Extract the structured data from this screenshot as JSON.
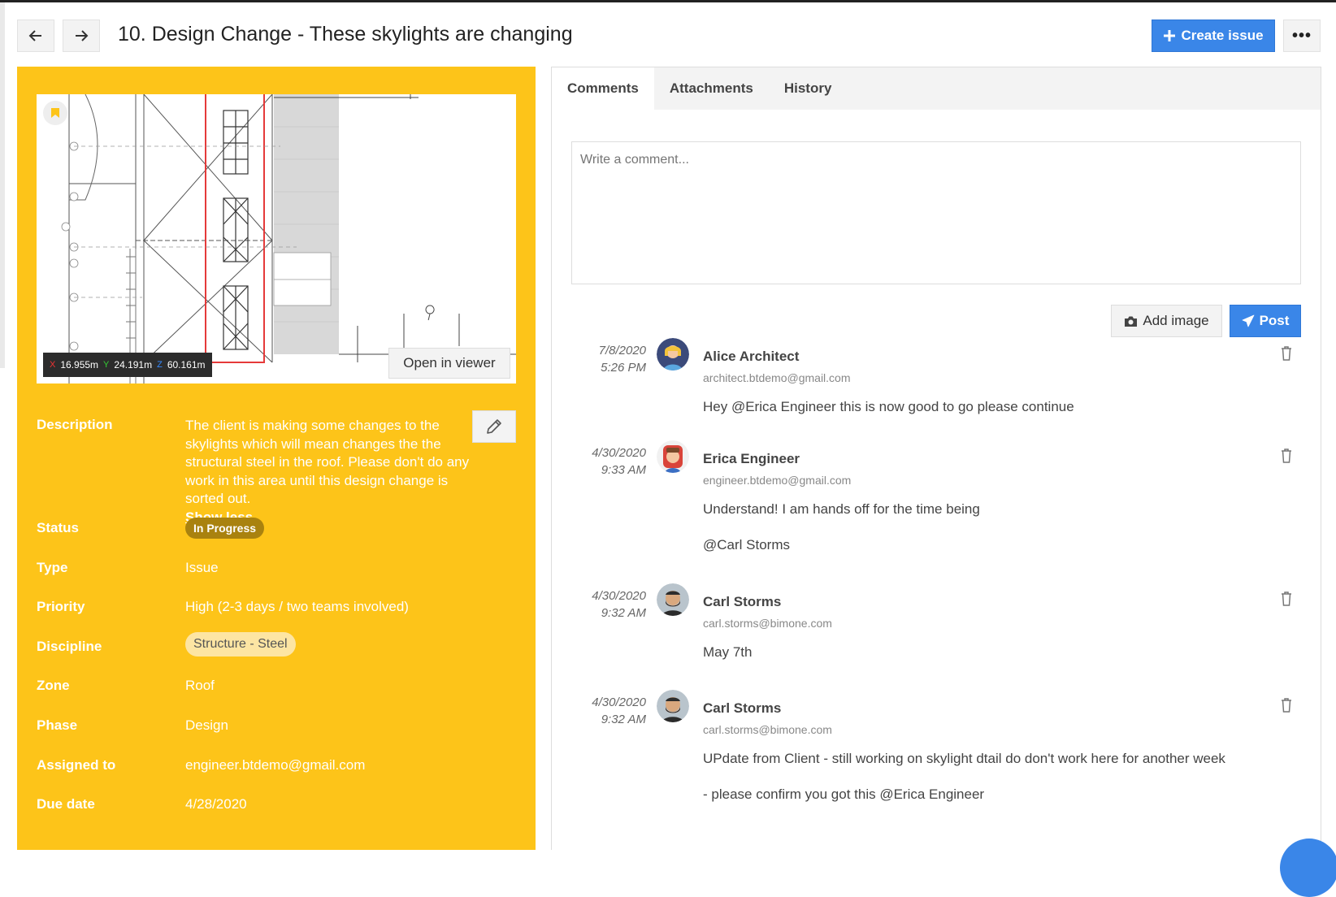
{
  "header": {
    "title": "10. Design Change - These skylights are changing",
    "create_label": "Create issue",
    "more_label": "•••"
  },
  "preview": {
    "coords": {
      "x": "16.955m",
      "y": "24.191m",
      "z": "60.161m"
    },
    "open_viewer_label": "Open in viewer"
  },
  "details": {
    "description_label": "Description",
    "description_text": "The client is making some changes to the skylights which will mean changes the the structural steel in the roof. Please don't do any work in this area until this design change is sorted out.",
    "show_less": "Show less",
    "status_label": "Status",
    "status_value": "In Progress",
    "type_label": "Type",
    "type_value": "Issue",
    "priority_label": "Priority",
    "priority_value": "High (2-3 days / two teams involved)",
    "discipline_label": "Discipline",
    "discipline_value": "Structure - Steel",
    "zone_label": "Zone",
    "zone_value": "Roof",
    "phase_label": "Phase",
    "phase_value": "Design",
    "assigned_label": "Assigned to",
    "assigned_value": "engineer.btdemo@gmail.com",
    "due_label": "Due date",
    "due_value": "4/28/2020"
  },
  "tabs": [
    "Comments",
    "Attachments",
    "History"
  ],
  "composer": {
    "placeholder": "Write a comment...",
    "add_image_label": "Add image",
    "post_label": "Post"
  },
  "comments": [
    {
      "date": "7/8/2020",
      "time": "5:26 PM",
      "name": "Alice Architect",
      "email": "architect.btdemo@gmail.com",
      "lines": [
        "Hey @Erica Engineer  this is now good to go please continue"
      ]
    },
    {
      "date": "4/30/2020",
      "time": "9:33 AM",
      "name": "Erica Engineer",
      "email": "engineer.btdemo@gmail.com",
      "lines": [
        "Understand! I am hands off for the time being",
        "@Carl Storms"
      ]
    },
    {
      "date": "4/30/2020",
      "time": "9:32 AM",
      "name": "Carl Storms",
      "email": "carl.storms@bimone.com",
      "lines": [
        "May 7th"
      ]
    },
    {
      "date": "4/30/2020",
      "time": "9:32 AM",
      "name": "Carl Storms",
      "email": "carl.storms@bimone.com",
      "lines": [
        "UPdate from Client - still working on skylight dtail do don't work here for another week",
        "- please confirm you got this @Erica Engineer"
      ]
    }
  ],
  "colors": {
    "panel": "#fdc419",
    "accent": "#3a86e8",
    "status_pill": "#a9820f",
    "discipline_pill": "#fde5a3"
  }
}
